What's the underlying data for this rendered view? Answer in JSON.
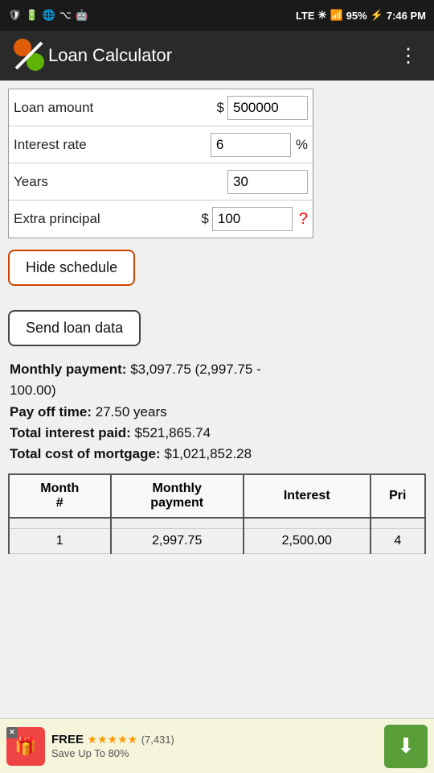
{
  "statusBar": {
    "leftIcons": [
      "shield",
      "battery-indicator",
      "emoji",
      "usb",
      "android"
    ],
    "network": "LTE",
    "signalBars": "▂▄▆█",
    "batteryPercent": "95%",
    "time": "7:46 PM"
  },
  "appBar": {
    "title": "Loan Calculator",
    "menuLabel": "⋮"
  },
  "form": {
    "loanAmountLabel": "Loan amount",
    "loanAmountPrefix": "$",
    "loanAmountValue": "500000",
    "interestRateLabel": "Interest rate",
    "interestRateSuffix": "%",
    "interestRateValue": "6",
    "yearsLabel": "Years",
    "yearsValue": "30",
    "extraPrincipalLabel": "Extra principal",
    "extraPrincipalPrefix": "$",
    "extraPrincipalValue": "100",
    "helpSymbol": "?"
  },
  "buttons": {
    "hideSchedule": "Hide schedule",
    "sendLoanData": "Send loan data"
  },
  "results": {
    "monthlyPaymentLabel": "Monthly payment:",
    "monthlyPaymentValue": "$3,097.75 (2,997.75 -",
    "monthlyPaymentValue2": "100.00)",
    "payOffTimeLabel": "Pay off time:",
    "payOffTimeValue": "27.50 years",
    "totalInterestLabel": "Total interest paid:",
    "totalInterestValue": "$521,865.74",
    "totalCostLabel": "Total cost of mortgage:",
    "totalCostValue": "$1,021,852.28"
  },
  "table": {
    "headers": [
      "Month #",
      "Monthly payment",
      "Interest",
      "Pri"
    ],
    "rows": [
      [
        "",
        "",
        "",
        ""
      ],
      [
        "1",
        "2,997.75",
        "2,500.00",
        "4"
      ]
    ]
  },
  "ad": {
    "freeLabel": "FREE",
    "stars": "★★★★★",
    "ratingText": "(7,431)",
    "subtitle": "Save Up To 80%",
    "closeLabel": "✕"
  }
}
